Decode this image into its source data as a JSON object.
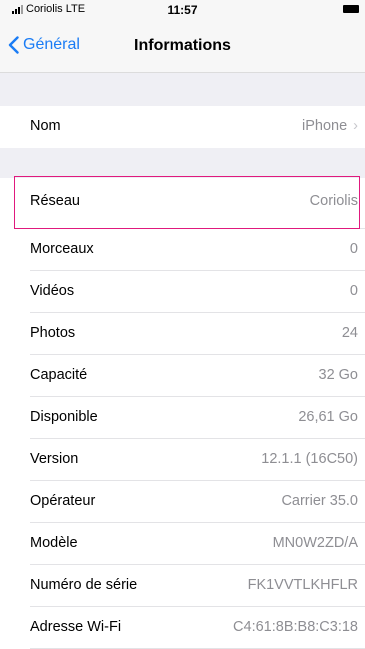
{
  "status": {
    "carrier": "Coriolis  LTE",
    "time": "11:57"
  },
  "nav": {
    "back_label": "Général",
    "title": "Informations"
  },
  "top_rows": [
    {
      "label": "Nom",
      "value": "iPhone"
    }
  ],
  "rows": [
    {
      "label": "Réseau",
      "value": "Coriolis"
    },
    {
      "label": "Morceaux",
      "value": "0"
    },
    {
      "label": "Vidéos",
      "value": "0"
    },
    {
      "label": "Photos",
      "value": "24"
    },
    {
      "label": "Capacité",
      "value": "32 Go"
    },
    {
      "label": "Disponible",
      "value": "26,61 Go"
    },
    {
      "label": "Version",
      "value": "12.1.1 (16C50)"
    },
    {
      "label": "Opérateur",
      "value": "Carrier 35.0"
    },
    {
      "label": "Modèle",
      "value": "MN0W2ZD/A"
    },
    {
      "label": "Numéro de série",
      "value": "FK1VVTLKHFLR"
    },
    {
      "label": "Adresse Wi-Fi",
      "value": "C4:61:8B:B8:C3:18"
    }
  ],
  "colors": {
    "accent": "#1a7cf5",
    "highlight": "#e0197d",
    "background": "#efeff4"
  }
}
